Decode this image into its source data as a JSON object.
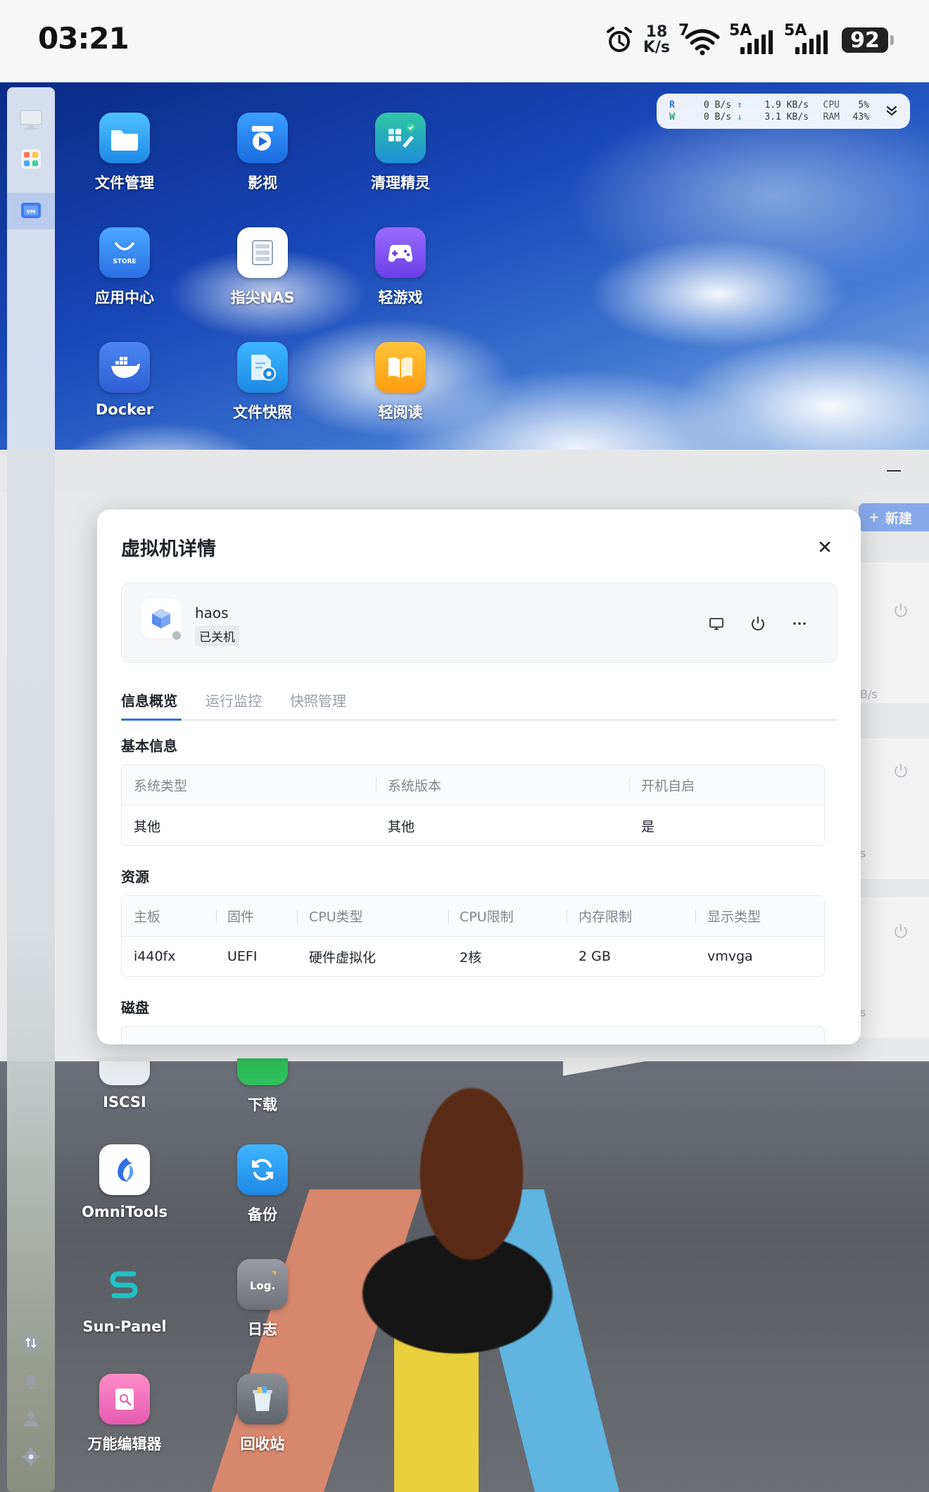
{
  "status_bar": {
    "time": "03:21",
    "net_speed_value": "18",
    "net_speed_unit": "K/s",
    "wifi_num": "7",
    "sim1": "5A",
    "sim2": "5A",
    "battery": "92"
  },
  "resource_widget": {
    "r_label": "R",
    "w_label": "W",
    "r_value": "0  B/s",
    "w_value": "0  B/s",
    "up_speed": "1.9 KB/s",
    "down_speed": "3.1 KB/s",
    "cpu_label": "CPU",
    "ram_label": "RAM",
    "cpu_pct": "5%",
    "ram_pct": "43%"
  },
  "desktop_apps_top": [
    {
      "label": "文件管理",
      "icon": "folder-icon"
    },
    {
      "label": "影视",
      "icon": "video-icon"
    },
    {
      "label": "清理精灵",
      "icon": "cleaner-icon"
    },
    {
      "label": "应用中心",
      "icon": "store-icon",
      "badge": "STORE"
    },
    {
      "label": "指尖NAS",
      "icon": "nas-icon"
    },
    {
      "label": "轻游戏",
      "icon": "gamepad-icon"
    },
    {
      "label": "Docker",
      "icon": "docker-icon"
    },
    {
      "label": "文件快照",
      "icon": "snapshot-icon"
    },
    {
      "label": "轻阅读",
      "icon": "book-icon"
    }
  ],
  "desktop_apps_bottom": [
    {
      "label": "ISCSI",
      "icon": "iscsi-icon"
    },
    {
      "label": "下载",
      "icon": "download-icon"
    },
    {
      "label": "OmniTools",
      "icon": "omnitools-icon"
    },
    {
      "label": "备份",
      "icon": "backup-icon"
    },
    {
      "label": "Sun-Panel",
      "icon": "sun-panel-icon"
    },
    {
      "label": "日志",
      "icon": "log-icon",
      "badge": "Log."
    },
    {
      "label": "万能编辑器",
      "icon": "editor-icon"
    },
    {
      "label": "回收站",
      "icon": "trash-icon"
    }
  ],
  "app_window": {
    "new_button": "新建",
    "faint_text_1": "B/s",
    "faint_text_2": "s",
    "faint_text_3": "s"
  },
  "modal": {
    "title": "虚拟机详情",
    "vm_name": "haos",
    "vm_status": "已关机",
    "tabs": [
      "信息概览",
      "运行监控",
      "快照管理"
    ],
    "active_tab": 0,
    "basic_info": {
      "title": "基本信息",
      "headers": [
        "系统类型",
        "系统版本",
        "开机自启"
      ],
      "values": [
        "其他",
        "其他",
        "是"
      ]
    },
    "resources": {
      "title": "资源",
      "headers": [
        "主板",
        "固件",
        "CPU类型",
        "CPU限制",
        "内存限制",
        "显示类型"
      ],
      "values": [
        "i440fx",
        "UEFI",
        "硬件虚拟化",
        "2核",
        "2 GB",
        "vmvga"
      ]
    },
    "disk": {
      "title": "磁盘"
    }
  },
  "colors": {
    "accent": "#2f6fe4",
    "sky": "#1848b8"
  }
}
